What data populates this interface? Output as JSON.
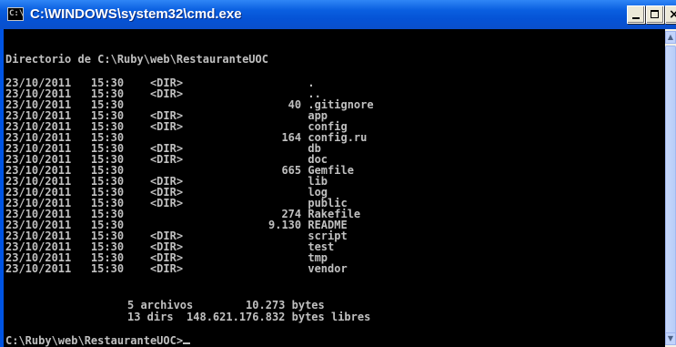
{
  "window": {
    "title": "C:\\WINDOWS\\system32\\cmd.exe",
    "icon_label": "C:\\",
    "controls": {
      "minimize": "minimize",
      "maximize": "maximize",
      "close": "×"
    }
  },
  "console": {
    "header": "Directorio de C:\\Ruby\\web\\RestauranteUOC",
    "entries": [
      {
        "date": "23/10/2011",
        "time": "15:30",
        "type": "<DIR>",
        "size": "",
        "name": "."
      },
      {
        "date": "23/10/2011",
        "time": "15:30",
        "type": "<DIR>",
        "size": "",
        "name": ".."
      },
      {
        "date": "23/10/2011",
        "time": "15:30",
        "type": "",
        "size": "40",
        "name": ".gitignore"
      },
      {
        "date": "23/10/2011",
        "time": "15:30",
        "type": "<DIR>",
        "size": "",
        "name": "app"
      },
      {
        "date": "23/10/2011",
        "time": "15:30",
        "type": "<DIR>",
        "size": "",
        "name": "config"
      },
      {
        "date": "23/10/2011",
        "time": "15:30",
        "type": "",
        "size": "164",
        "name": "config.ru"
      },
      {
        "date": "23/10/2011",
        "time": "15:30",
        "type": "<DIR>",
        "size": "",
        "name": "db"
      },
      {
        "date": "23/10/2011",
        "time": "15:30",
        "type": "<DIR>",
        "size": "",
        "name": "doc"
      },
      {
        "date": "23/10/2011",
        "time": "15:30",
        "type": "",
        "size": "665",
        "name": "Gemfile"
      },
      {
        "date": "23/10/2011",
        "time": "15:30",
        "type": "<DIR>",
        "size": "",
        "name": "lib"
      },
      {
        "date": "23/10/2011",
        "time": "15:30",
        "type": "<DIR>",
        "size": "",
        "name": "log"
      },
      {
        "date": "23/10/2011",
        "time": "15:30",
        "type": "<DIR>",
        "size": "",
        "name": "public"
      },
      {
        "date": "23/10/2011",
        "time": "15:30",
        "type": "",
        "size": "274",
        "name": "Rakefile"
      },
      {
        "date": "23/10/2011",
        "time": "15:30",
        "type": "",
        "size": "9.130",
        "name": "README"
      },
      {
        "date": "23/10/2011",
        "time": "15:30",
        "type": "<DIR>",
        "size": "",
        "name": "script"
      },
      {
        "date": "23/10/2011",
        "time": "15:30",
        "type": "<DIR>",
        "size": "",
        "name": "test"
      },
      {
        "date": "23/10/2011",
        "time": "15:30",
        "type": "<DIR>",
        "size": "",
        "name": "tmp"
      },
      {
        "date": "23/10/2011",
        "time": "15:30",
        "type": "<DIR>",
        "size": "",
        "name": "vendor"
      }
    ],
    "summary_files": "5 archivos        10.273 bytes",
    "summary_dirs": "13 dirs  148.621.176.832 bytes libres",
    "prompt": "C:\\Ruby\\web\\RestauranteUOC>"
  },
  "colors": {
    "console_bg": "#000000",
    "console_fg": "#c0c0c0",
    "titlebar": "#0553d6"
  }
}
